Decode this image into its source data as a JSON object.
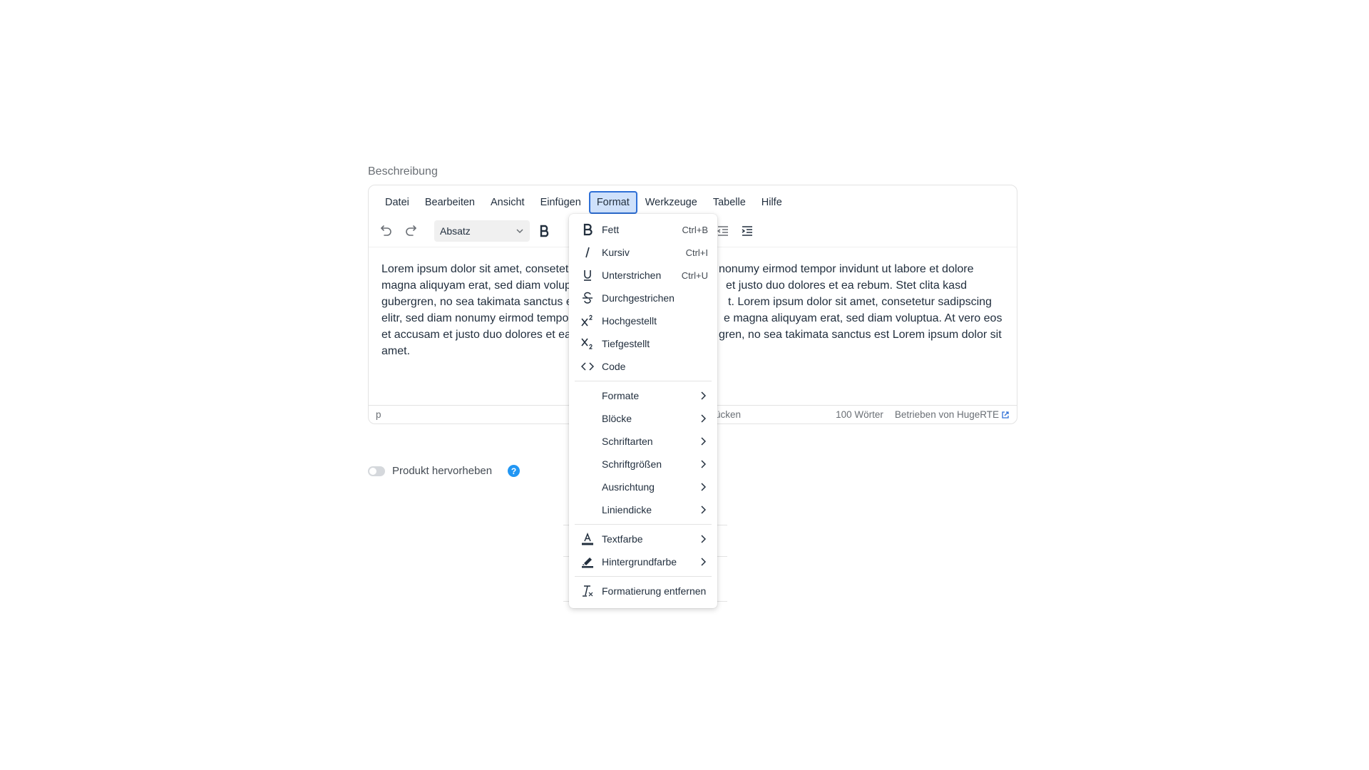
{
  "field": {
    "label": "Beschreibung"
  },
  "menubar": {
    "items": [
      "Datei",
      "Bearbeiten",
      "Ansicht",
      "Einfügen",
      "Format",
      "Werkzeuge",
      "Tabelle",
      "Hilfe"
    ]
  },
  "toolbar": {
    "undo_icon": "undo-icon",
    "redo_icon": "redo-icon",
    "block_format": "Absatz"
  },
  "content": {
    "text_left_1": "Lorem ipsum dolor sit amet, consetet",
    "text_right_1": "nonumy eirmod tempor invidunt ut labore et dolore",
    "text_left_2": "magna aliquyam erat, sed diam volup",
    "text_right_2": "et justo duo dolores et ea rebum. Stet clita kasd",
    "text_left_3": "gubergren, no sea takimata sanctus e",
    "text_right_3": "t. Lorem ipsum dolor sit amet, consetetur sadipscing",
    "text_left_4": "elitr, sed diam nonumy eirmod tempo",
    "text_right_4": "e magna aliquyam erat, sed diam voluptua. At vero eos",
    "text_left_5": "et accusam et justo duo dolores et ea",
    "text_right_5": "gren, no sea takimata sanctus est Lorem ipsum dolor sit",
    "text_left_6": "amet."
  },
  "statusbar": {
    "path": "p",
    "partial": "ücken",
    "word_count": "100 Wörter",
    "brand": "Betrieben von HugeRTE"
  },
  "toggle": {
    "label": "Produkt hervorheben",
    "help": "?"
  },
  "format_menu": {
    "items": [
      {
        "icon": "bold-icon",
        "label": "Fett",
        "shortcut": "Ctrl+B"
      },
      {
        "icon": "italic-icon",
        "label": "Kursiv",
        "shortcut": "Ctrl+I"
      },
      {
        "icon": "underline-icon",
        "label": "Unterstrichen",
        "shortcut": "Ctrl+U"
      },
      {
        "icon": "strikethrough-icon",
        "label": "Durchgestrichen",
        "shortcut": ""
      },
      {
        "icon": "superscript-icon",
        "label": "Hochgestellt",
        "shortcut": ""
      },
      {
        "icon": "subscript-icon",
        "label": "Tiefgestellt",
        "shortcut": ""
      },
      {
        "icon": "code-icon",
        "label": "Code",
        "shortcut": ""
      }
    ],
    "submenus": [
      "Formate",
      "Blöcke",
      "Schriftarten",
      "Schriftgrößen",
      "Ausrichtung",
      "Liniendicke"
    ],
    "colors": [
      {
        "icon": "text-color-icon",
        "label": "Textfarbe"
      },
      {
        "icon": "highlight-icon",
        "label": "Hintergrundfarbe"
      }
    ],
    "remove": {
      "icon": "remove-format-icon",
      "label": "Formatierung entfernen"
    }
  }
}
